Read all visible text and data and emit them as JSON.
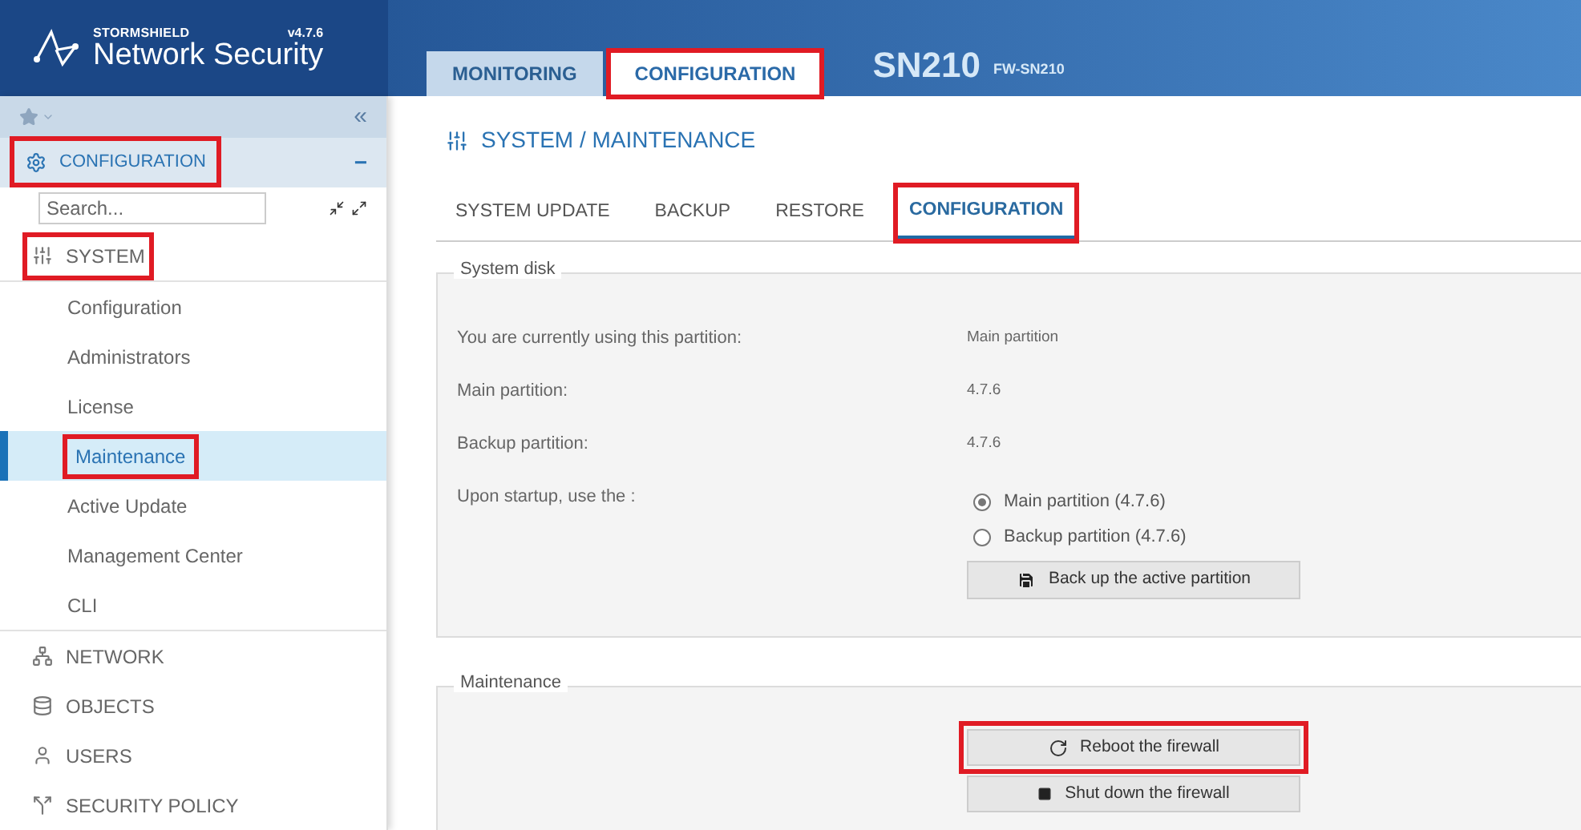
{
  "header": {
    "brand": "STORMSHIELD",
    "version": "v4.7.6",
    "product": "Network Security",
    "device": "SN210",
    "device_name": "FW-SN210",
    "tabs": [
      {
        "label": "MONITORING",
        "selected": false,
        "highlighted": false
      },
      {
        "label": "CONFIGURATION",
        "selected": true,
        "highlighted": true
      }
    ]
  },
  "sidebar": {
    "collapse": "«",
    "section": {
      "label": "CONFIGURATION",
      "toggle": "−",
      "highlighted": true
    },
    "search": {
      "placeholder": "Search..."
    },
    "groups": [
      {
        "label": "SYSTEM",
        "kind": "system",
        "highlighted": true,
        "children": [
          {
            "label": "Configuration",
            "selected": false,
            "highlighted": false
          },
          {
            "label": "Administrators",
            "selected": false,
            "highlighted": false
          },
          {
            "label": "License",
            "selected": false,
            "highlighted": false
          },
          {
            "label": "Maintenance",
            "selected": true,
            "highlighted": true
          },
          {
            "label": "Active Update",
            "selected": false,
            "highlighted": false
          },
          {
            "label": "Management Center",
            "selected": false,
            "highlighted": false
          },
          {
            "label": "CLI",
            "selected": false,
            "highlighted": false
          }
        ]
      },
      {
        "label": "NETWORK",
        "kind": "network",
        "highlighted": false
      },
      {
        "label": "OBJECTS",
        "kind": "objects",
        "highlighted": false
      },
      {
        "label": "USERS",
        "kind": "users",
        "highlighted": false
      },
      {
        "label": "SECURITY POLICY",
        "kind": "policy",
        "highlighted": false
      }
    ]
  },
  "main": {
    "title": "SYSTEM / MAINTENANCE",
    "tabs": [
      {
        "label": "SYSTEM UPDATE",
        "selected": false,
        "highlighted": false
      },
      {
        "label": "BACKUP",
        "selected": false,
        "highlighted": false
      },
      {
        "label": "RESTORE",
        "selected": false,
        "highlighted": false
      },
      {
        "label": "CONFIGURATION",
        "selected": true,
        "highlighted": true
      }
    ],
    "system_disk": {
      "legend": "System disk",
      "rows": [
        {
          "label": "You are currently using this partition:",
          "value": "Main partition"
        },
        {
          "label": "Main partition:",
          "value": "4.7.6"
        },
        {
          "label": "Backup partition:",
          "value": "4.7.6"
        }
      ],
      "startup": {
        "label": "Upon startup, use the :",
        "options": [
          {
            "label": "Main partition (4.7.6)",
            "selected": true
          },
          {
            "label": "Backup partition (4.7.6)",
            "selected": false
          }
        ]
      },
      "button": "Back up the active partition"
    },
    "maintenance": {
      "legend": "Maintenance",
      "buttons": [
        {
          "label": "Reboot the firewall",
          "kind": "reboot",
          "highlighted": true
        },
        {
          "label": "Shut down the firewall",
          "kind": "shutdown",
          "highlighted": false
        }
      ]
    }
  }
}
